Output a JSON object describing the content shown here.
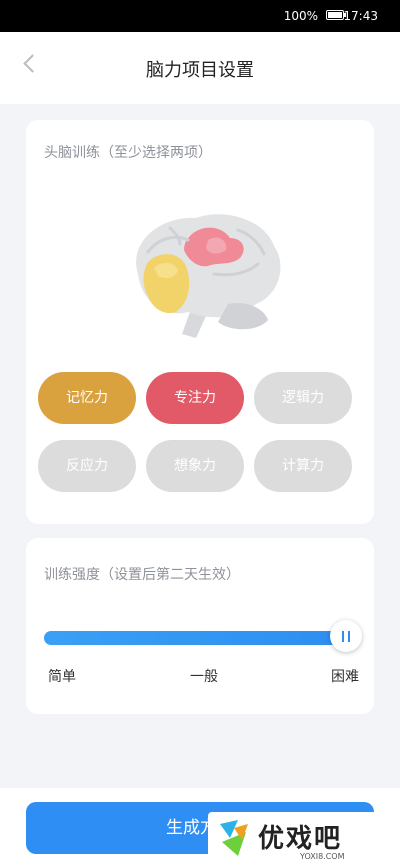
{
  "status_bar": {
    "battery_text": "100%",
    "time": "17:43",
    "battery_level": 1.0
  },
  "header": {
    "title": "脑力项目设置",
    "back_icon": "chevron-left-icon"
  },
  "brain_training": {
    "title": "头脑训练（至少选择两项）",
    "illustration_icon": "brain-icon",
    "options": [
      {
        "label": "记忆力",
        "selected": true,
        "color": "#d9a23f"
      },
      {
        "label": "专注力",
        "selected": true,
        "color": "#e25a68"
      },
      {
        "label": "逻辑力",
        "selected": false,
        "color": "#dcdcdc"
      },
      {
        "label": "反应力",
        "selected": false,
        "color": "#dcdcdc"
      },
      {
        "label": "想象力",
        "selected": false,
        "color": "#dcdcdc"
      },
      {
        "label": "计算力",
        "selected": false,
        "color": "#dcdcdc"
      }
    ]
  },
  "intensity": {
    "title": "训练强度（设置后第二天生效）",
    "levels": [
      "简单",
      "一般",
      "困难"
    ],
    "value_fraction": 1.0,
    "accent_color": "#2d8ef0"
  },
  "cta": {
    "label": "生成方案"
  },
  "watermark": {
    "brand": "优戏吧",
    "url": "YOXI8.COM"
  }
}
